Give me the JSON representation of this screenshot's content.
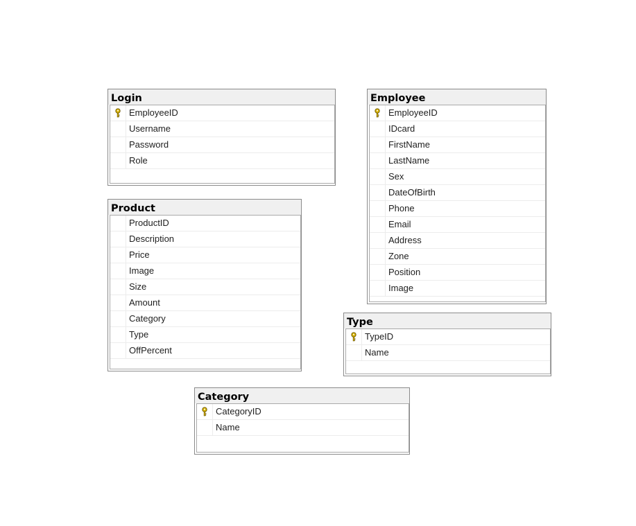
{
  "tables": {
    "login": {
      "title": "Login",
      "columns": [
        {
          "name": "EmployeeID",
          "icon": "primary-key-icon"
        },
        {
          "name": "Username",
          "icon": ""
        },
        {
          "name": "Password",
          "icon": ""
        },
        {
          "name": "Role",
          "icon": ""
        }
      ]
    },
    "employee": {
      "title": "Employee",
      "columns": [
        {
          "name": "EmployeeID",
          "icon": "primary-key-icon"
        },
        {
          "name": "IDcard",
          "icon": ""
        },
        {
          "name": "FirstName",
          "icon": ""
        },
        {
          "name": "LastName",
          "icon": ""
        },
        {
          "name": "Sex",
          "icon": ""
        },
        {
          "name": "DateOfBirth",
          "icon": ""
        },
        {
          "name": "Phone",
          "icon": ""
        },
        {
          "name": "Email",
          "icon": ""
        },
        {
          "name": "Address",
          "icon": ""
        },
        {
          "name": "Zone",
          "icon": ""
        },
        {
          "name": "Position",
          "icon": ""
        },
        {
          "name": "Image",
          "icon": ""
        }
      ]
    },
    "product": {
      "title": "Product",
      "columns": [
        {
          "name": "ProductID",
          "icon": ""
        },
        {
          "name": "Description",
          "icon": ""
        },
        {
          "name": "Price",
          "icon": ""
        },
        {
          "name": "Image",
          "icon": ""
        },
        {
          "name": "Size",
          "icon": ""
        },
        {
          "name": "Amount",
          "icon": ""
        },
        {
          "name": "Category",
          "icon": ""
        },
        {
          "name": "Type",
          "icon": ""
        },
        {
          "name": "OffPercent",
          "icon": ""
        }
      ]
    },
    "type": {
      "title": "Type",
      "columns": [
        {
          "name": "TypeID",
          "icon": "primary-key-icon"
        },
        {
          "name": "Name",
          "icon": ""
        }
      ]
    },
    "category": {
      "title": "Category",
      "columns": [
        {
          "name": "CategoryID",
          "icon": "primary-key-icon"
        },
        {
          "name": "Name",
          "icon": ""
        }
      ]
    }
  },
  "colors": {
    "title_bar": "#f0f0f0",
    "border": "#8a8a8a",
    "key_icon": "#d8b400"
  }
}
